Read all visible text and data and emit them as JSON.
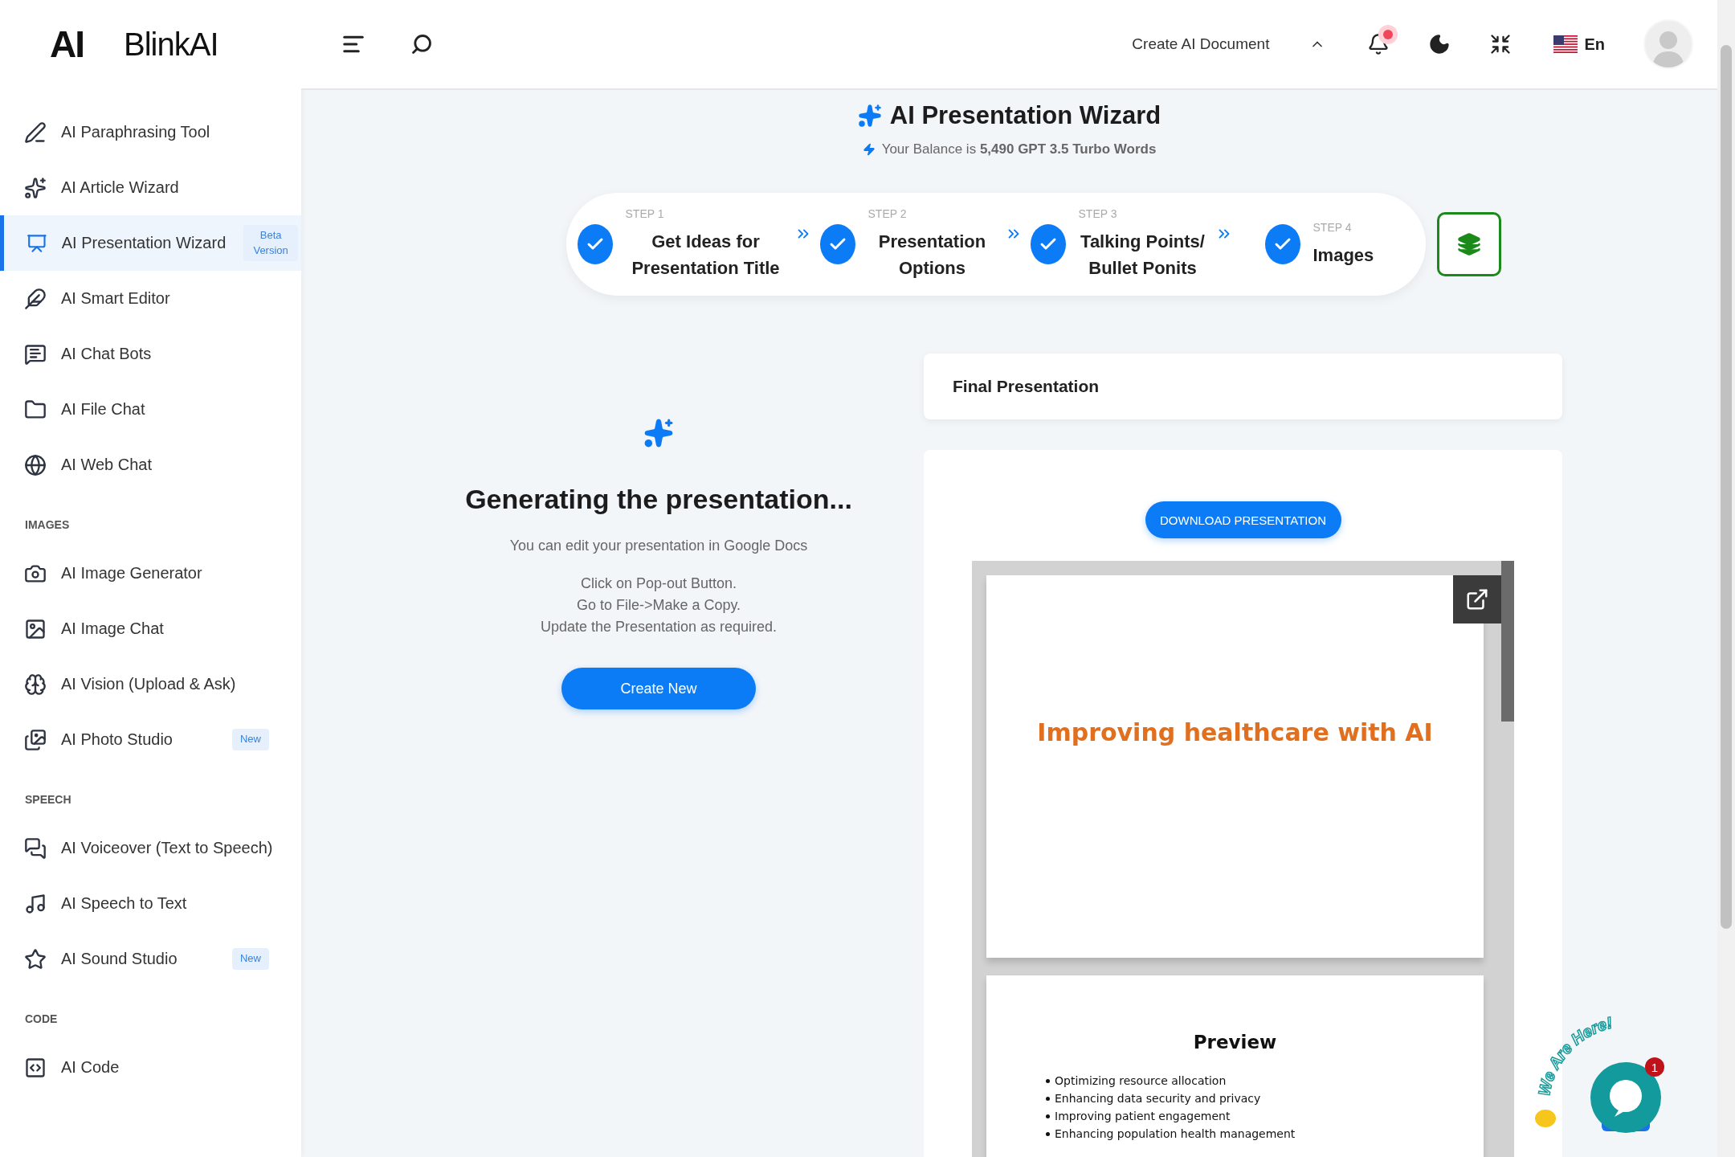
{
  "brand": {
    "mark": "AI",
    "name": "BlinkAI"
  },
  "sidebar": {
    "sections": [
      {
        "items": [
          {
            "label": "AI Paraphrasing Tool",
            "selected": false
          },
          {
            "label": "AI Article Wizard",
            "selected": false
          },
          {
            "label": "AI Presentation Wizard",
            "selected": true,
            "badge": "Beta Version"
          },
          {
            "label": "AI Smart Editor",
            "selected": false
          },
          {
            "label": "AI Chat Bots",
            "selected": false
          },
          {
            "label": "AI File Chat",
            "selected": false
          },
          {
            "label": "AI Web Chat",
            "selected": false
          }
        ]
      },
      {
        "title": "IMAGES",
        "items": [
          {
            "label": "AI Image Generator",
            "selected": false
          },
          {
            "label": "AI Image Chat",
            "selected": false
          },
          {
            "label": "AI Vision (Upload & Ask)",
            "selected": false
          },
          {
            "label": "AI Photo Studio",
            "selected": false,
            "badge": "New"
          }
        ]
      },
      {
        "title": "SPEECH",
        "items": [
          {
            "label": "AI Voiceover (Text to Speech)",
            "selected": false
          },
          {
            "label": "AI Speech to Text",
            "selected": false
          },
          {
            "label": "AI Sound Studio",
            "selected": false,
            "badge": "New"
          }
        ]
      },
      {
        "title": "CODE",
        "items": [
          {
            "label": "AI Code",
            "selected": false
          }
        ]
      }
    ]
  },
  "topbar": {
    "document_menu": "Create AI Document",
    "notifications_unread": true,
    "language": "En"
  },
  "wizard": {
    "title": "AI Presentation Wizard",
    "balance": "Your Balance is **5,490 GPT 3.5 Turbo Words**",
    "steps": [
      {
        "step": "STEP 1",
        "label": "Get Ideas for Presentation Title",
        "done": true
      },
      {
        "step": "STEP 2",
        "label": "Presentation Options",
        "done": true
      },
      {
        "step": "STEP 3",
        "label": "Talking Points/ Bullet Ponits",
        "done": true
      },
      {
        "step": "STEP 4",
        "label": "Images",
        "done": true
      }
    ]
  },
  "generating": {
    "heading": "Generating the presentation...",
    "lines": [
      "You can edit your presentation in Google Docs",
      "Click on Pop-out Button.",
      "Go to File->Make a Copy.",
      "Update the Presentation as required."
    ],
    "button": "Create New"
  },
  "final": {
    "title": "Final Presentation",
    "download": "DOWNLOAD PRESENTATION",
    "slides": [
      {
        "kind": "title",
        "title": "Improving healthcare with AI"
      },
      {
        "kind": "bullets",
        "title": "Preview",
        "bullets": [
          "Optimizing resource allocation",
          "Enhancing data security and privacy",
          "Improving patient engagement",
          "Enhancing population health management"
        ]
      }
    ]
  },
  "chat_widget": {
    "label": "We Are Here!",
    "unread": "1"
  }
}
